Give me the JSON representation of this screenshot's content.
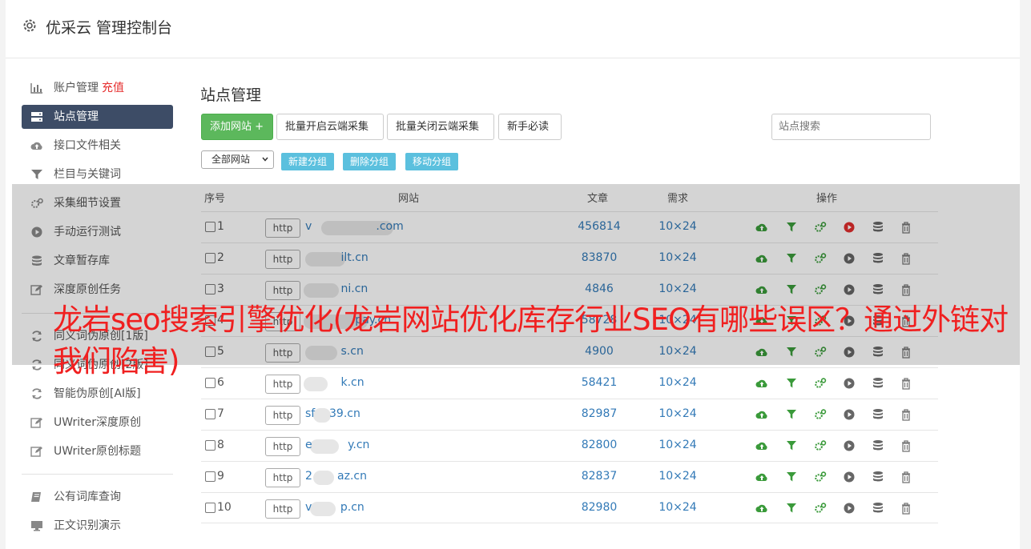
{
  "header": {
    "title": "优采云 管理控制台",
    "icon": "gear-icon"
  },
  "sidebar": {
    "items": [
      {
        "label": "账户管理",
        "badge": "充值",
        "icon": "bar-chart-icon"
      },
      {
        "label": "站点管理",
        "icon": "server-icon",
        "active": true
      },
      {
        "label": "接口文件相关",
        "icon": "cloud-upload-icon"
      },
      {
        "label": "栏目与关键词",
        "icon": "filter-icon"
      },
      {
        "label": "采集细节设置",
        "icon": "cogs-icon"
      },
      {
        "label": "手动运行测试",
        "icon": "play-circle-icon"
      },
      {
        "label": "文章暂存库",
        "icon": "database-icon"
      },
      {
        "label": "深度原创任务",
        "icon": "edit-icon"
      },
      {
        "label": "同义词伪原创[1版]",
        "icon": "refresh-icon"
      },
      {
        "label": "同义词伪原创[2版]",
        "icon": "refresh-icon"
      },
      {
        "label": "智能伪原创[AI版]",
        "icon": "refresh-icon"
      },
      {
        "label": "UWriter深度原创",
        "icon": "edit-icon"
      },
      {
        "label": "UWriter原创标题",
        "icon": "edit-icon"
      },
      {
        "label": "公有词库查询",
        "icon": "book-icon"
      },
      {
        "label": "正文识别演示",
        "icon": "monitor-icon"
      }
    ]
  },
  "content": {
    "title": "站点管理",
    "toolbar": {
      "add_label": "添加网站 +",
      "batch_open_label": "批量开启云端采集",
      "batch_close_label": "批量关闭云端采集",
      "guide_label": "新手必读",
      "search_placeholder": "站点搜索"
    },
    "group_select": "全部网站",
    "group_buttons": {
      "new": "新建分组",
      "delete": "删除分组",
      "move": "移动分组"
    },
    "table": {
      "headers": {
        "index": "序号",
        "site": "网站",
        "articles": "文章",
        "demand": "需求",
        "actions": "操作"
      },
      "http_label": "http",
      "rows": [
        {
          "num": "1",
          "site": "v                  .com",
          "articles": "456814",
          "demand": "10×24",
          "running": true
        },
        {
          "num": "2",
          "site": "          ilt.cn",
          "articles": "83870",
          "demand": "10×24"
        },
        {
          "num": "3",
          "site": "          ni.cn",
          "articles": "4846",
          "demand": "10×24"
        },
        {
          "num": "4",
          "site": "              pay.cn",
          "articles": "58728",
          "demand": "10×24"
        },
        {
          "num": "5",
          "site": "          s.cn",
          "articles": "4900",
          "demand": "10×24"
        },
        {
          "num": "6",
          "site": "          k.cn",
          "articles": "58421",
          "demand": "10×24"
        },
        {
          "num": "7",
          "site": "sf    39.cn",
          "articles": "82987",
          "demand": "10×24"
        },
        {
          "num": "8",
          "site": "e          y.cn",
          "articles": "82800",
          "demand": "10×24"
        },
        {
          "num": "9",
          "site": "2       az.cn",
          "articles": "82837",
          "demand": "10×24"
        },
        {
          "num": "10",
          "site": "v        p.cn",
          "articles": "82980",
          "demand": "10×24"
        }
      ]
    }
  },
  "overlay": {
    "text": "龙岩seo搜索引擎优化(龙岩网站优化库存行业SEO有哪些误区？通过外链对我们陷害)"
  },
  "colors": {
    "accent_green": "#5cb85c",
    "info_blue": "#5bc0de",
    "active_nav": "#3d4c66",
    "link_blue": "#337ab7",
    "overlay_red": "#f02020"
  }
}
